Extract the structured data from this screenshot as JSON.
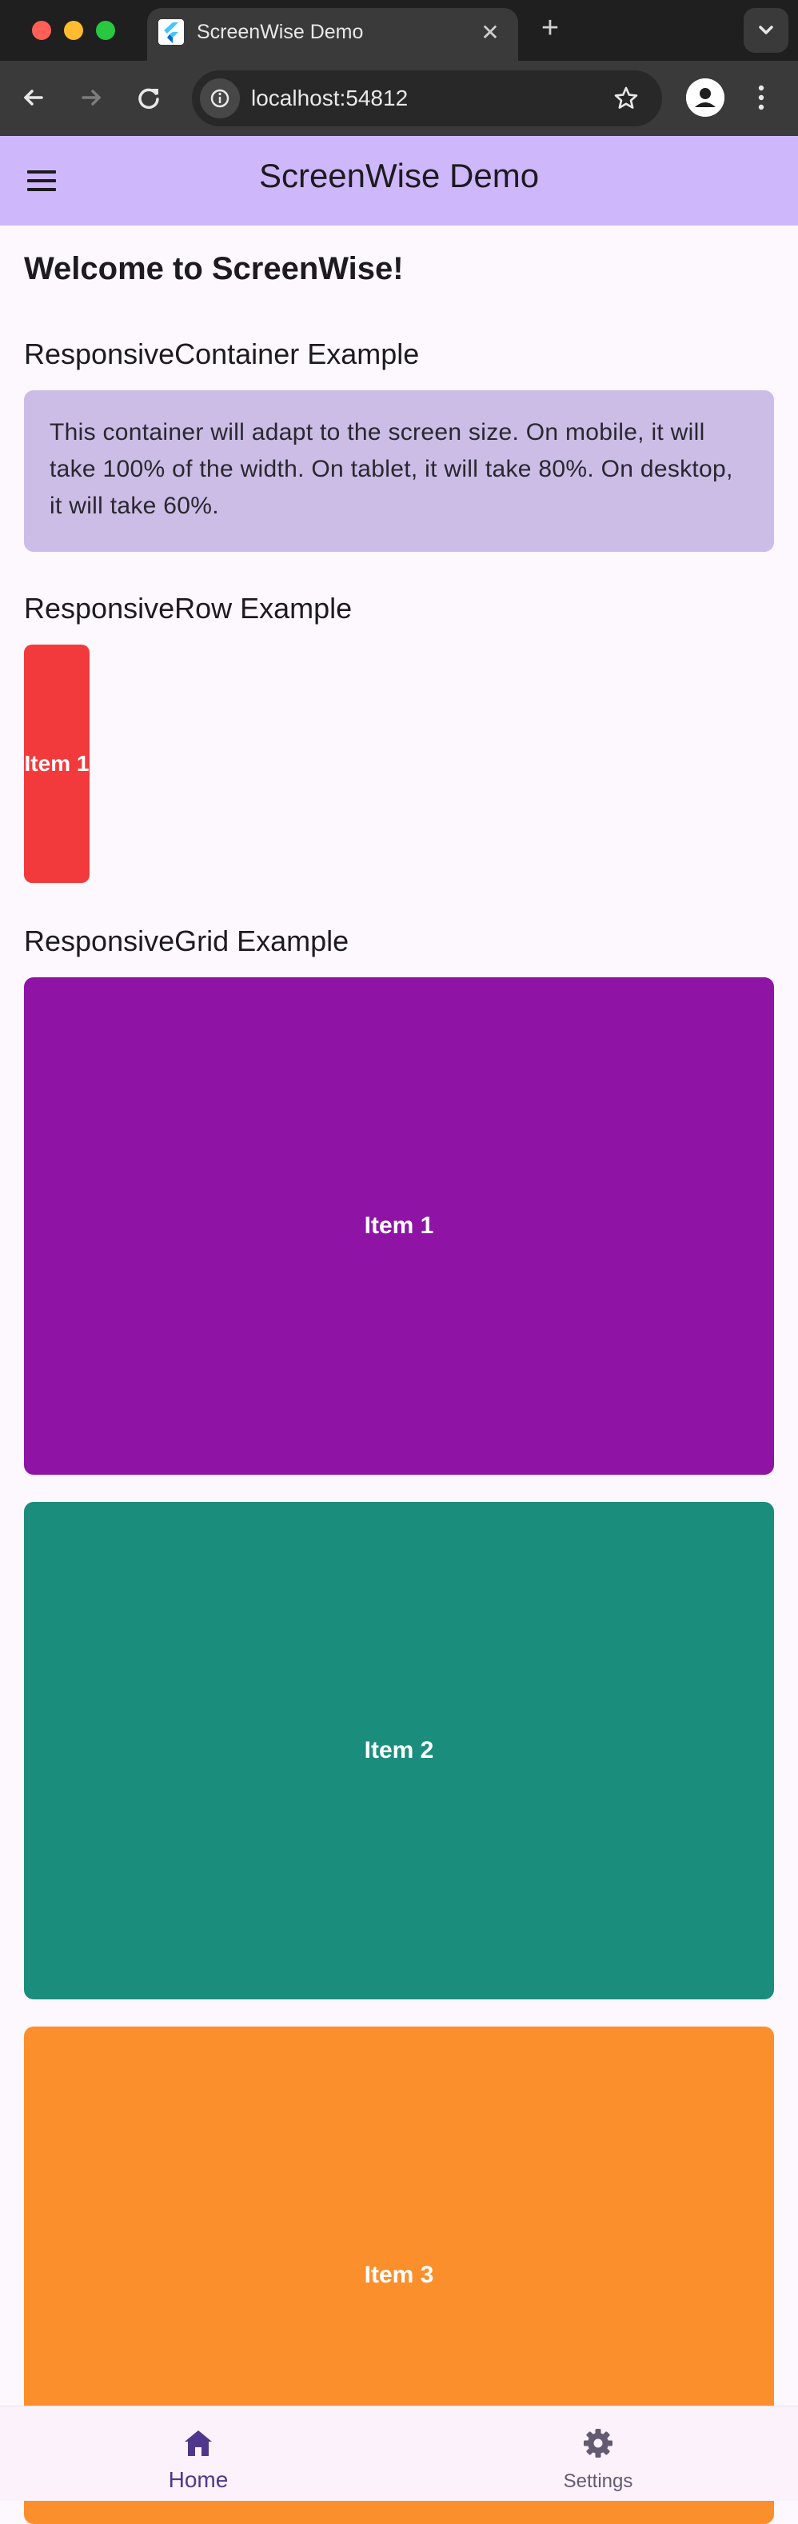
{
  "browser": {
    "tab_title": "ScreenWise Demo",
    "url": "localhost:54812"
  },
  "appbar": {
    "title": "ScreenWise Demo"
  },
  "main": {
    "welcome": "Welcome to ScreenWise!",
    "responsive_container": {
      "title": "ResponsiveContainer Example",
      "text": "This container will adapt to the screen size. On mobile, it will take 100% of the width. On tablet, it will take 80%. On desktop, it will take 60%."
    },
    "responsive_row": {
      "title": "ResponsiveRow Example",
      "items": [
        {
          "label": "Item 1",
          "color": "#f23a3d"
        }
      ]
    },
    "responsive_grid": {
      "title": "ResponsiveGrid Example",
      "items": [
        {
          "label": "Item 1",
          "color": "#8f14a6"
        },
        {
          "label": "Item 2",
          "color": "#1b8d7c"
        },
        {
          "label": "Item 3",
          "color": "#fb8f2c"
        }
      ]
    }
  },
  "bottom_nav": {
    "items": [
      {
        "label": "Home",
        "icon": "home-icon",
        "selected": true
      },
      {
        "label": "Settings",
        "icon": "gear-icon",
        "selected": false
      }
    ]
  },
  "colors": {
    "appbar_bg": "#cfb7fc",
    "page_bg": "#fdf7fe",
    "container_bg": "#cbbde5",
    "nav_selected": "#4f378b",
    "nav_unselected": "#625b71"
  }
}
